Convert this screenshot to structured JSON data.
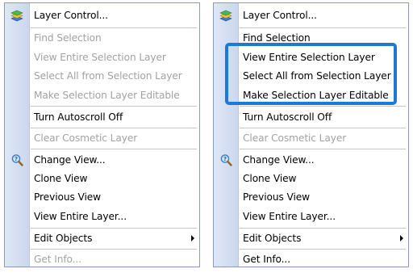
{
  "menus": [
    {
      "items": {
        "layer_control": "Layer Control...",
        "find_selection": "Find Selection",
        "view_entire_selection_layer": "View Entire Selection Layer",
        "select_all_from_selection_layer": "Select All from Selection Layer",
        "make_selection_layer_editable": "Make Selection Layer Editable",
        "turn_autoscroll_off": "Turn Autoscroll Off",
        "clear_cosmetic_layer": "Clear Cosmetic Layer",
        "change_view": "Change View...",
        "clone_view": "Clone View",
        "previous_view": "Previous View",
        "view_entire_layer": "View Entire Layer...",
        "edit_objects": "Edit Objects",
        "get_info": "Get Info..."
      },
      "disabled": [
        "find_selection",
        "view_entire_selection_layer",
        "select_all_from_selection_layer",
        "make_selection_layer_editable",
        "clear_cosmetic_layer",
        "get_info"
      ]
    },
    {
      "items": {
        "layer_control": "Layer Control...",
        "find_selection": "Find Selection",
        "view_entire_selection_layer": "View Entire Selection Layer",
        "select_all_from_selection_layer": "Select All from Selection Layer",
        "make_selection_layer_editable": "Make Selection Layer Editable",
        "turn_autoscroll_off": "Turn Autoscroll Off",
        "clear_cosmetic_layer": "Clear Cosmetic Layer",
        "change_view": "Change View...",
        "clone_view": "Clone View",
        "previous_view": "Previous View",
        "view_entire_layer": "View Entire Layer...",
        "edit_objects": "Edit Objects",
        "get_info": "Get Info..."
      },
      "disabled": [
        "clear_cosmetic_layer"
      ]
    }
  ],
  "icons": {
    "layer_control": "layers-stack-icon",
    "change_view": "magnifier-question-icon",
    "edit_objects": "submenu-arrow-icon"
  },
  "colors": {
    "highlight_border": "#1a7ad6",
    "gutter": "#d6dff2",
    "disabled_text": "#a2a2a2",
    "menu_border": "#8a99c2"
  }
}
